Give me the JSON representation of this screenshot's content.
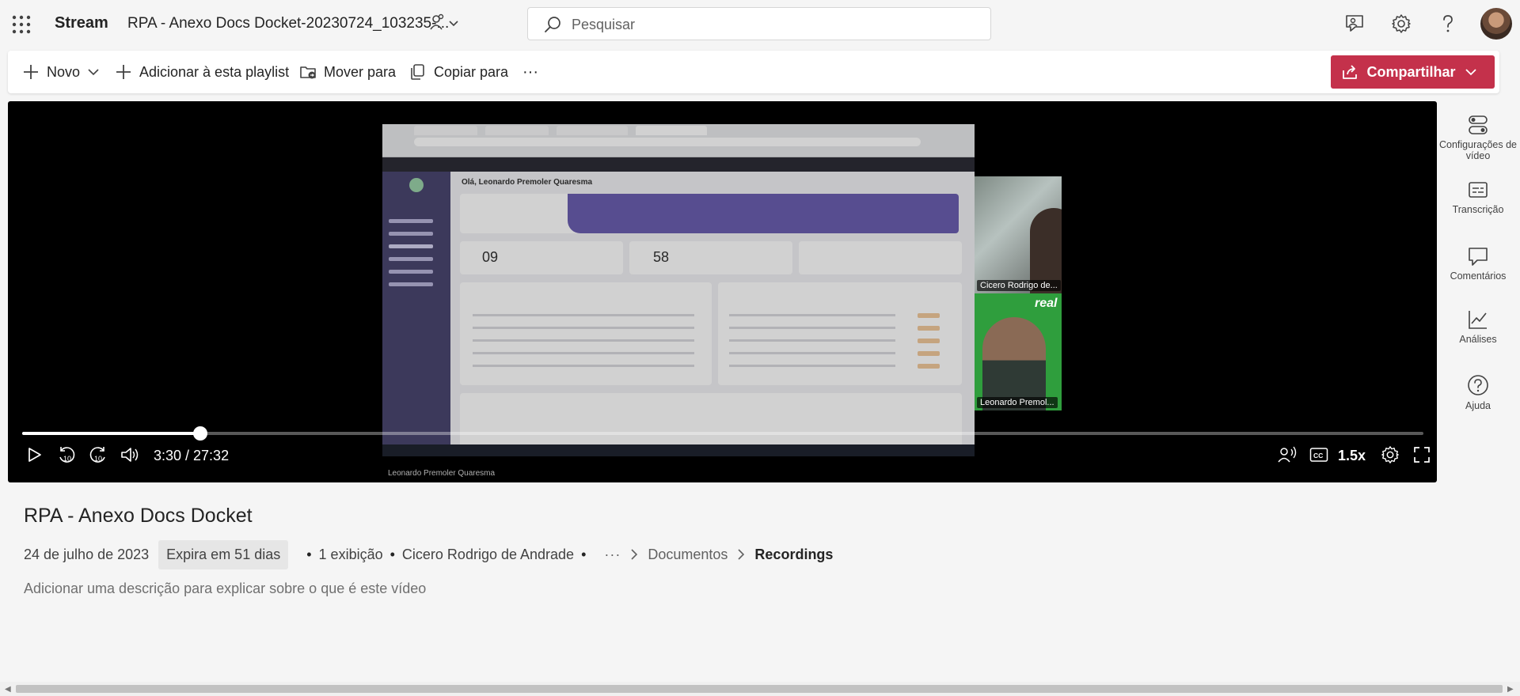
{
  "header": {
    "app_name": "Stream",
    "document_title": "RPA - Anexo Docs Docket-20230724_103235-...",
    "search_placeholder": "Pesquisar"
  },
  "toolbar": {
    "new_label": "Novo",
    "add_to_playlist_label": "Adicionar à esta playlist",
    "move_label": "Mover para",
    "copy_label": "Copiar para",
    "more_label": "···",
    "share_label": "Compartilhar"
  },
  "player": {
    "current_time": "3:30",
    "duration": "27:32",
    "time_display": "3:30 / 27:32",
    "progress_fraction": 0.127,
    "buffered_fraction": 0.14,
    "speed": "1.5x",
    "presenter_caption": "Leonardo Premoler Quaresma",
    "participants": [
      {
        "name": "Cicero Rodrigo de..."
      },
      {
        "name": "Leonardo Premol..."
      }
    ],
    "shared_screen": {
      "greeting": "Olá, Leonardo Premoler Quaresma",
      "stat1": "09",
      "stat2": "58"
    }
  },
  "right_rail": {
    "items": [
      {
        "label": "Configurações de vídeo",
        "icon": "settings-toggle-icon"
      },
      {
        "label": "Transcrição",
        "icon": "transcript-icon"
      },
      {
        "label": "Comentários",
        "icon": "comment-icon"
      },
      {
        "label": "Análises",
        "icon": "analytics-icon"
      },
      {
        "label": "Ajuda",
        "icon": "help-icon"
      }
    ]
  },
  "details": {
    "title": "RPA - Anexo Docs Docket",
    "date": "24 de julho de 2023",
    "expiry": "Expira em 51 dias",
    "views": "1 exibição",
    "author": "Cicero Rodrigo de Andrade",
    "breadcrumb_more": "···",
    "breadcrumb": [
      "Documentos",
      "Recordings"
    ],
    "description_placeholder": "Adicionar uma descrição para explicar sobre o que é este vídeo"
  },
  "colors": {
    "accent": "#c4314b",
    "page_background": "#f5f5f5"
  }
}
